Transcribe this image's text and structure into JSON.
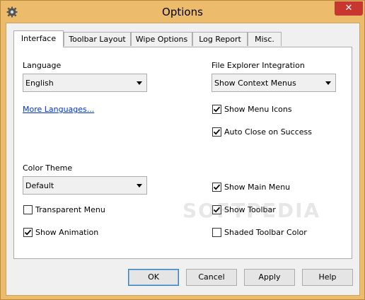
{
  "window": {
    "title": "Options",
    "close_glyph": "✕",
    "icon": "gear-icon"
  },
  "tabs": [
    {
      "label": "Interface",
      "active": true
    },
    {
      "label": "Toolbar Layout",
      "active": false
    },
    {
      "label": "Wipe Options",
      "active": false
    },
    {
      "label": "Log Report",
      "active": false
    },
    {
      "label": "Misc.",
      "active": false
    }
  ],
  "interface": {
    "language_label": "Language",
    "language_value": "English",
    "more_languages_link": "More Languages...",
    "color_theme_label": "Color Theme",
    "color_theme_value": "Default",
    "transparent_menu": {
      "label": "Transparent Menu",
      "checked": false
    },
    "show_animation": {
      "label": "Show Animation",
      "checked": true
    },
    "explorer_label": "File Explorer Integration",
    "explorer_value": "Show Context Menus",
    "show_menu_icons": {
      "label": "Show Menu Icons",
      "checked": true
    },
    "auto_close": {
      "label": "Auto Close on Success",
      "checked": true
    },
    "show_main_menu": {
      "label": "Show Main Menu",
      "checked": true
    },
    "show_toolbar": {
      "label": "Show Toolbar",
      "checked": true
    },
    "shaded_toolbar": {
      "label": "Shaded Toolbar Color",
      "checked": false
    }
  },
  "buttons": {
    "ok": "OK",
    "cancel": "Cancel",
    "apply": "Apply",
    "help": "Help"
  },
  "watermark": "SOFTPEDIA",
  "colors": {
    "frame": "#ecbc6c",
    "close": "#c7372f",
    "link": "#0033cc"
  }
}
